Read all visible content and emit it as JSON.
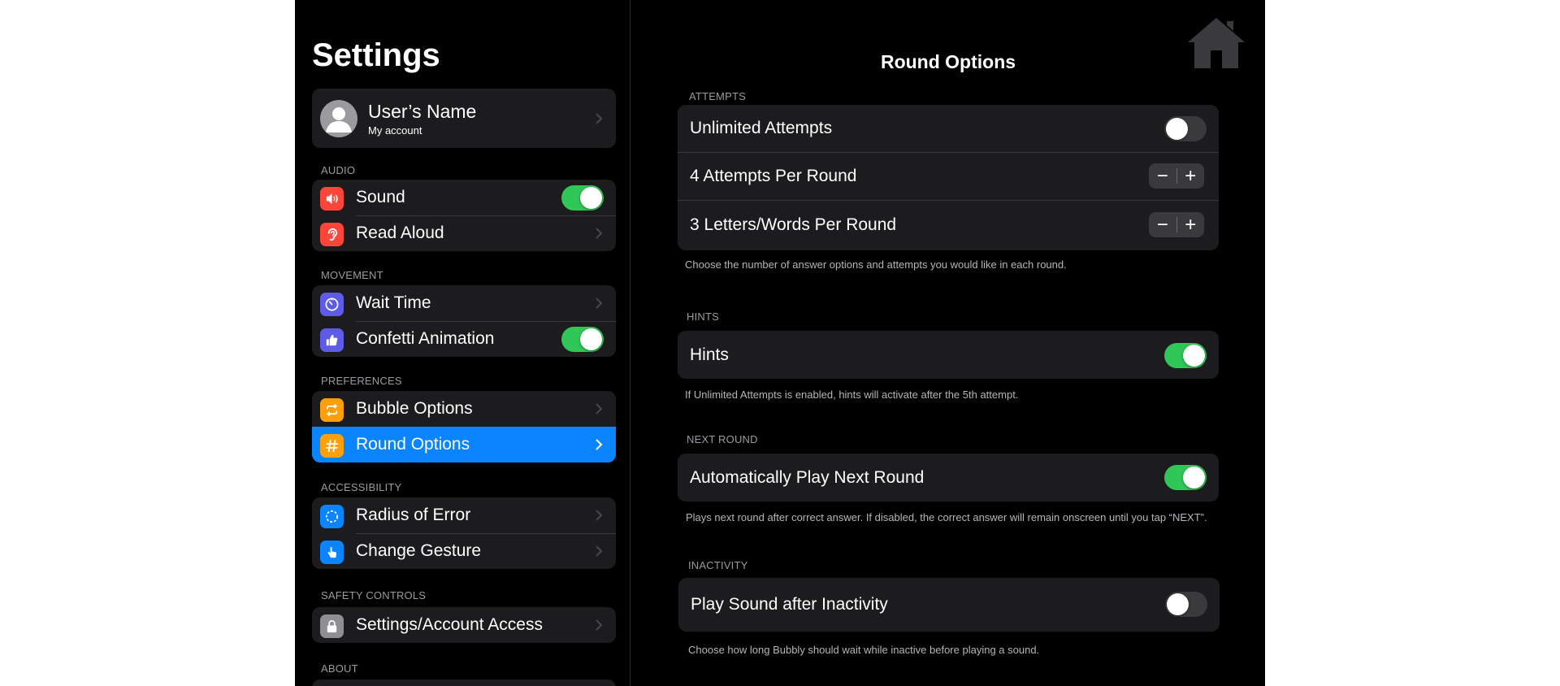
{
  "sidebar": {
    "title": "Settings",
    "account": {
      "name": "User’s Name",
      "subtitle": "My account"
    },
    "sections": {
      "audio": "AUDIO",
      "movement": "MOVEMENT",
      "preferences": "PREFERENCES",
      "accessibility": "ACCESSIBILITY",
      "safety": "SAFETY CONTROLS",
      "about": "ABOUT"
    },
    "items": {
      "sound": {
        "label": "Sound",
        "icon": "speaker-icon",
        "color": "#ff453a",
        "toggle": true
      },
      "read_aloud": {
        "label": "Read Aloud",
        "icon": "ear-icon",
        "color": "#ff453a"
      },
      "wait_time": {
        "label": "Wait Time",
        "icon": "timer-icon",
        "color": "#5e5ce6"
      },
      "confetti": {
        "label": "Confetti Animation",
        "icon": "thumbs-up-icon",
        "color": "#5e5ce6",
        "toggle": true
      },
      "bubble_options": {
        "label": "Bubble Options",
        "icon": "repeat-icon",
        "color": "#ff9f0a"
      },
      "round_options": {
        "label": "Round Options",
        "icon": "hashtag-icon",
        "color": "#ff9f0a",
        "selected": true
      },
      "radius_of_error": {
        "label": "Radius of Error",
        "icon": "dashed-circle-icon",
        "color": "#0a84ff"
      },
      "change_gesture": {
        "label": "Change Gesture",
        "icon": "hand-tap-icon",
        "color": "#0a84ff"
      },
      "account_access": {
        "label": "Settings/Account Access",
        "icon": "lock-icon",
        "color": "#8e8e93"
      }
    }
  },
  "main": {
    "title": "Round Options",
    "attempts": {
      "section": "ATTEMPTS",
      "unlimited_label": "Unlimited Attempts",
      "unlimited_on": false,
      "per_round_label": "4 Attempts Per Round",
      "letters_label": "3 Letters/Words Per Round",
      "minus": "−",
      "plus": "+",
      "note": "Choose the number of answer options and attempts you would like in each round."
    },
    "hints": {
      "section": "HINTS",
      "label": "Hints",
      "on": true,
      "note": "If Unlimited Attempts is enabled, hints will activate after the 5th attempt."
    },
    "next_round": {
      "section": "NEXT ROUND",
      "label": "Automatically Play Next Round",
      "on": true,
      "note": "Plays next round after correct answer. If disabled, the correct answer will remain onscreen until you tap “NEXT”."
    },
    "inactivity": {
      "section": "INACTIVITY",
      "label": "Play Sound after Inactivity",
      "on": false,
      "note": "Choose how long Bubbly should wait while inactive before playing a sound."
    }
  },
  "colors": {
    "accent": "#0a84ff",
    "toggle_on": "#30c759",
    "card": "#1c1c1e"
  }
}
